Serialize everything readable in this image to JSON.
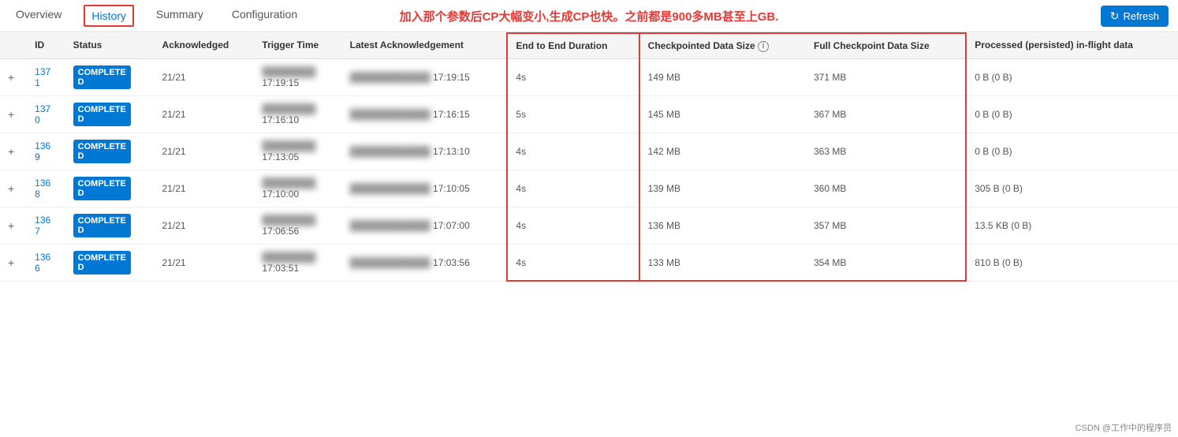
{
  "tabs": [
    {
      "label": "Overview",
      "active": false
    },
    {
      "label": "History",
      "active": true
    },
    {
      "label": "Summary",
      "active": false
    },
    {
      "label": "Configuration",
      "active": false
    }
  ],
  "annotation": "加入那个参数后CP大幅变小,生成CP也快。之前都是900多MB甚至上GB.",
  "refresh_label": "Refresh",
  "columns": {
    "id": "ID",
    "status": "Status",
    "acknowledged": "Acknowledged",
    "trigger_time": "Trigger Time",
    "latest_ack": "Latest Acknowledgement",
    "end_to_end": "End to End Duration",
    "checkpointed_size": "Checkpointed Data Size",
    "full_checkpoint": "Full Checkpoint Data Size",
    "processed": "Processed (persisted) in-flight data"
  },
  "rows": [
    {
      "id": "1371",
      "status": "COMPLETED",
      "acknowledged": "21/21",
      "trigger_time": "17:19:15",
      "latest_ack_blurred": true,
      "latest_ack": "17:19:15",
      "duration": "4s",
      "checkpointed": "149 MB",
      "full_checkpoint": "371 MB",
      "processed": "0 B (0 B)"
    },
    {
      "id": "1370",
      "status": "COMPLETED",
      "acknowledged": "21/21",
      "trigger_time": "17:16:10",
      "latest_ack_blurred": true,
      "latest_ack": "17:16:15",
      "duration": "5s",
      "checkpointed": "145 MB",
      "full_checkpoint": "367 MB",
      "processed": "0 B (0 B)"
    },
    {
      "id": "1369",
      "status": "COMPLETED",
      "acknowledged": "21/21",
      "trigger_time": "17:13:05",
      "latest_ack_blurred": true,
      "latest_ack": "17:13:10",
      "duration": "4s",
      "checkpointed": "142 MB",
      "full_checkpoint": "363 MB",
      "processed": "0 B (0 B)"
    },
    {
      "id": "1368",
      "status": "COMPLETED",
      "acknowledged": "21/21",
      "trigger_time": "17:10:00",
      "latest_ack_blurred": true,
      "latest_ack": "17:10:05",
      "duration": "4s",
      "checkpointed": "139 MB",
      "full_checkpoint": "360 MB",
      "processed": "305 B (0 B)"
    },
    {
      "id": "1367",
      "status": "COMPLETED",
      "acknowledged": "21/21",
      "trigger_time": "17:06:56",
      "latest_ack_blurred": true,
      "latest_ack": "17:07:00",
      "duration": "4s",
      "checkpointed": "136 MB",
      "full_checkpoint": "357 MB",
      "processed": "13.5 KB (0 B)"
    },
    {
      "id": "1366",
      "status": "COMPLETED",
      "acknowledged": "21/21",
      "trigger_time": "17:03:51",
      "latest_ack_blurred": true,
      "latest_ack": "17:03:56",
      "duration": "4s",
      "checkpointed": "133 MB",
      "full_checkpoint": "354 MB",
      "processed": "810 B (0 B)"
    }
  ],
  "watermark": "CSDN @工作中的程序员"
}
